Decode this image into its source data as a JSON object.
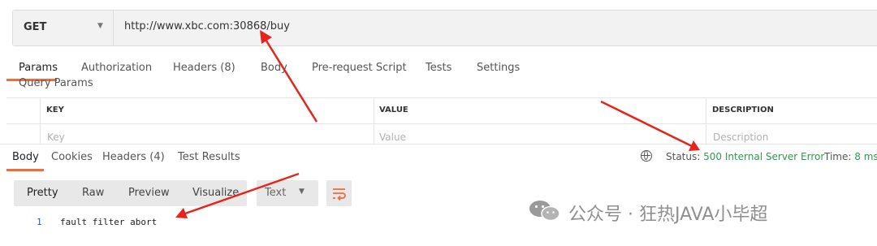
{
  "request": {
    "method": "GET",
    "url": "http://www.xbc.com:30868/buy"
  },
  "request_tabs": [
    {
      "label": "Params"
    },
    {
      "label": "Authorization"
    },
    {
      "label": "Headers",
      "badge": "(8)"
    },
    {
      "label": "Body"
    },
    {
      "label": "Pre-request Script"
    },
    {
      "label": "Tests"
    },
    {
      "label": "Settings"
    }
  ],
  "query_params": {
    "title": "Query Params",
    "columns": [
      "KEY",
      "VALUE",
      "DESCRIPTION"
    ],
    "placeholders": [
      "Key",
      "Value",
      "Description"
    ]
  },
  "response_tabs": [
    {
      "label": "Body"
    },
    {
      "label": "Cookies"
    },
    {
      "label": "Headers",
      "badge": "(4)"
    },
    {
      "label": "Test Results"
    }
  ],
  "response_status": {
    "status_label": "Status:",
    "status_value": "500 Internal Server Error",
    "time_label": "Time:",
    "time_value": "8 ms"
  },
  "format_buttons": [
    "Pretty",
    "Raw",
    "Preview",
    "Visualize"
  ],
  "type_select": "Text",
  "response_body": {
    "line_number": "1",
    "content": "fault filter abort"
  },
  "watermark": "公众号 · 狂热JAVA小毕超",
  "colors": {
    "accent": "#f26b3a",
    "status_green": "#2e9a4f",
    "arrow_red": "#e8231c"
  }
}
